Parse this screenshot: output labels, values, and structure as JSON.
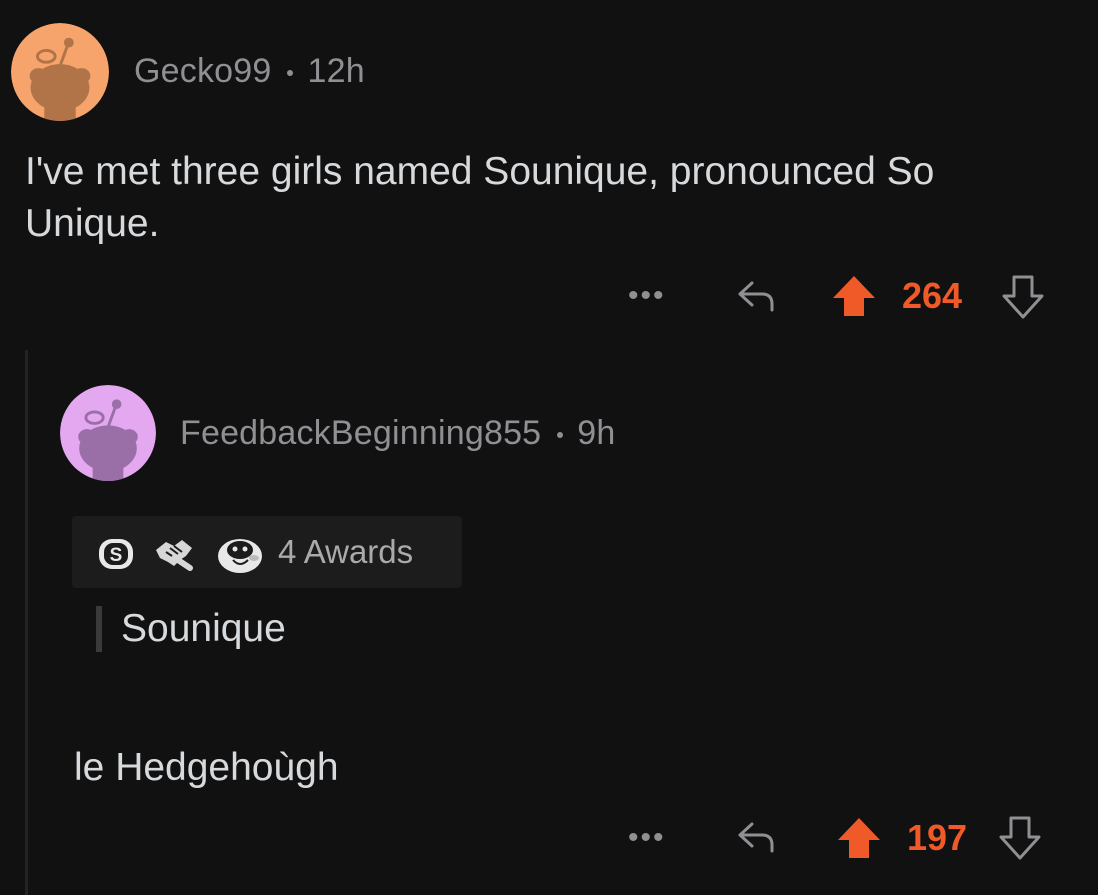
{
  "comment1": {
    "username": "Gecko99",
    "age": "12h",
    "body": "I've met three girls named Sounique, pronounced So Unique.",
    "more": "•••",
    "score": "264",
    "avatar_color": "#f7a36c"
  },
  "comment2": {
    "username": "FeedbackBeginning855",
    "age": "9h",
    "awards_label": "4 Awards",
    "quote": "Sounique",
    "body": "le Hedgehoùgh",
    "more": "•••",
    "score": "197",
    "avatar_color": "#e4a8f0"
  },
  "colors": {
    "upvote": "#f05a28",
    "muted": "#8e9093",
    "background": "#111112"
  },
  "icons": {
    "reply": "reply-arrow-icon",
    "upvote": "upvote-arrow-icon",
    "downvote": "downvote-arrow-icon"
  }
}
